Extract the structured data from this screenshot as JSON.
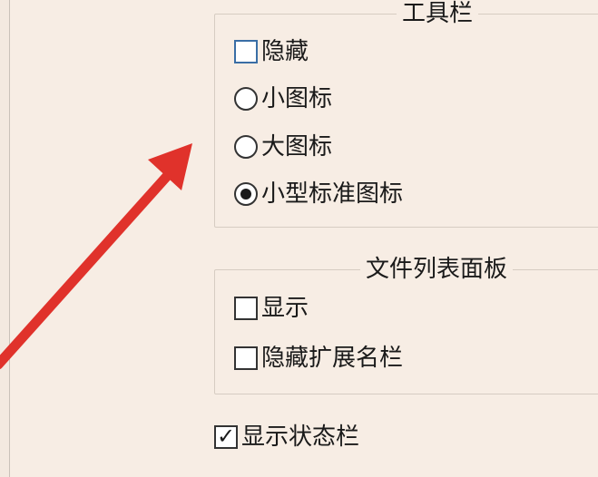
{
  "toolbar": {
    "title": "工具栏",
    "hide": {
      "label": "隐藏",
      "checked": false
    },
    "small_icons": {
      "label": "小图标",
      "selected": false
    },
    "large_icons": {
      "label": "大图标",
      "selected": false
    },
    "small_standard_icons": {
      "label": "小型标准图标",
      "selected": true
    }
  },
  "file_list_panel": {
    "title": "文件列表面板",
    "show": {
      "label": "显示",
      "checked": false
    },
    "hide_ext_column": {
      "label": "隐藏扩展名栏",
      "checked": false
    }
  },
  "status_bar": {
    "show": {
      "label": "显示状态栏",
      "checked": true
    }
  },
  "colors": {
    "background": "#f7ede4",
    "annotation_arrow": "#e0322b",
    "focus_border": "#3a6ea5"
  },
  "annotation": {
    "icon": "red-arrow-icon"
  }
}
